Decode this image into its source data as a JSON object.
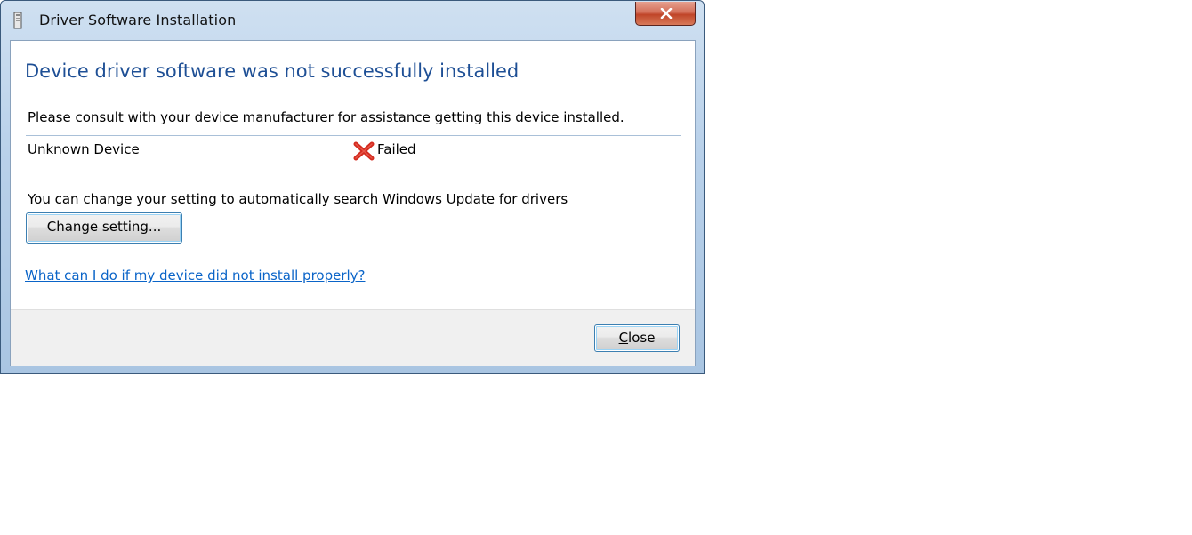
{
  "window": {
    "title": "Driver Software Installation",
    "icons": {
      "app": "driver-install-icon",
      "close": "close-icon"
    }
  },
  "content": {
    "heading": "Device driver software was not successfully installed",
    "consult_message": "Please consult with your device manufacturer for assistance getting this device installed.",
    "device": {
      "name": "Unknown Device",
      "status": "Failed",
      "status_icon": "red-x-icon"
    },
    "setting_message": "You can change your setting to automatically search Windows Update for drivers",
    "change_setting_label": "Change setting...",
    "help_link": "What can I do if my device did not install properly?"
  },
  "footer": {
    "close_label_mnemonic": "C",
    "close_label_rest": "lose"
  },
  "colors": {
    "heading": "#1e4f95",
    "link": "#0a64c8",
    "failed_icon": "#d32a1e",
    "footer_bg": "#f0f0f0"
  }
}
